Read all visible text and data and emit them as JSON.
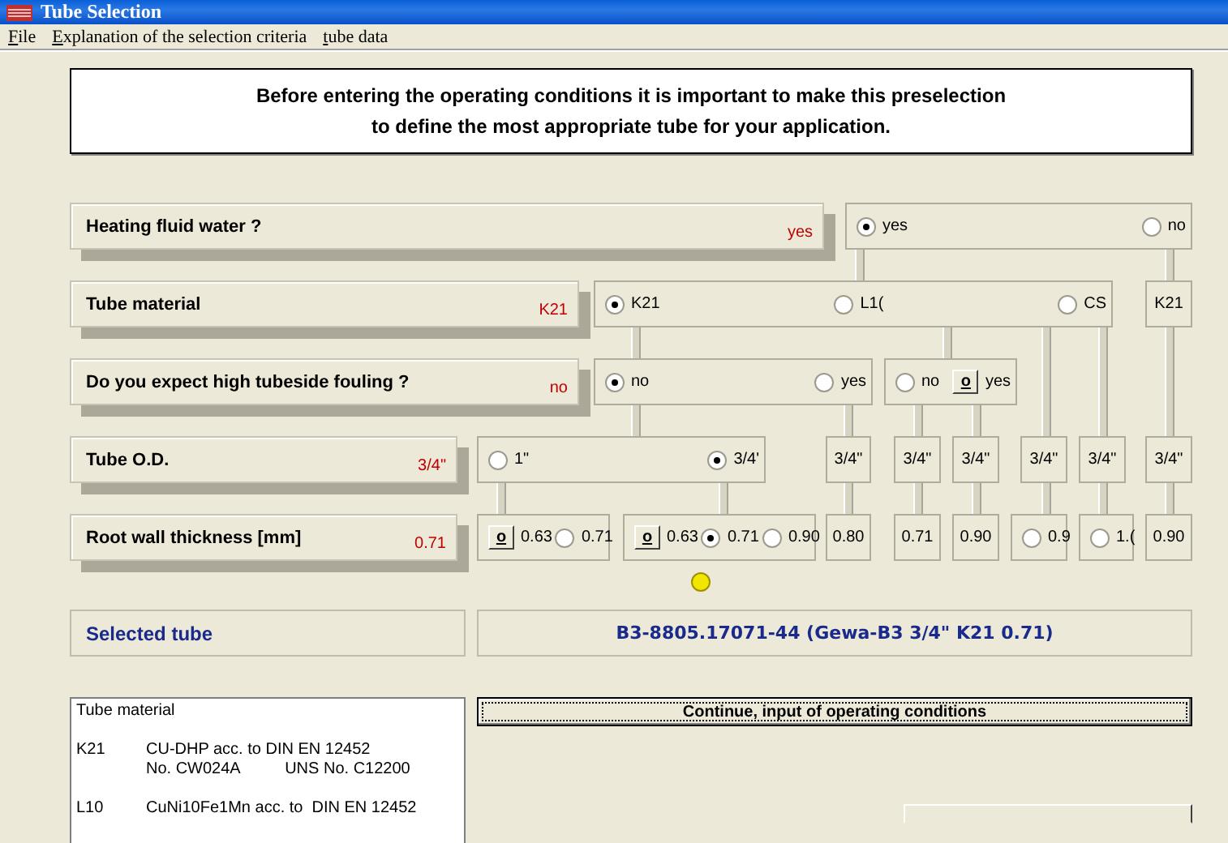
{
  "window": {
    "title": "Tube Selection"
  },
  "menu": [
    "File",
    "Explanation of the selection criteria",
    "tube data"
  ],
  "intro": [
    "Before entering the operating conditions it is important to make this preselection",
    "to define the most appropriate tube for your application."
  ],
  "questions": [
    {
      "label": "Heating fluid water ?",
      "value": "yes"
    },
    {
      "label": "Tube material",
      "value": "K21"
    },
    {
      "label": "Do you expect high tubeside fouling ?",
      "value": "no"
    },
    {
      "label": "Tube O.D.",
      "value": "3/4\""
    },
    {
      "label": "Root wall thickness [mm]",
      "value": "0.71"
    }
  ],
  "rows": [
    {
      "groups": [
        {
          "options": [
            {
              "kind": "radio",
              "label": "yes",
              "selected": true
            },
            {
              "kind": "radio",
              "label": "no",
              "selected": false
            }
          ]
        }
      ]
    },
    {
      "groups": [
        {
          "options": [
            {
              "kind": "radio",
              "label": "K21",
              "selected": true
            },
            {
              "kind": "radio",
              "label": "L1(",
              "selected": false
            },
            {
              "kind": "radio",
              "label": "CS",
              "selected": false
            }
          ]
        },
        {
          "options": [
            {
              "kind": "text",
              "label": "K21"
            }
          ]
        }
      ]
    },
    {
      "groups": [
        {
          "options": [
            {
              "kind": "radio",
              "label": "no",
              "selected": true
            },
            {
              "kind": "radio",
              "label": "yes",
              "selected": false
            }
          ]
        },
        {
          "options": [
            {
              "kind": "radio",
              "label": "no",
              "selected": false
            },
            {
              "kind": "button",
              "glyph": "o",
              "label": "yes"
            }
          ]
        }
      ]
    },
    {
      "groups": [
        {
          "options": [
            {
              "kind": "radio",
              "label": "1\"",
              "selected": false
            },
            {
              "kind": "radio",
              "label": "3/4'",
              "selected": true
            }
          ]
        },
        {
          "options": [
            {
              "kind": "text",
              "label": "3/4\""
            }
          ]
        },
        {
          "options": [
            {
              "kind": "text",
              "label": "3/4\""
            }
          ]
        },
        {
          "options": [
            {
              "kind": "text",
              "label": "3/4\""
            }
          ]
        },
        {
          "options": [
            {
              "kind": "text",
              "label": "3/4\""
            }
          ]
        },
        {
          "options": [
            {
              "kind": "text",
              "label": "3/4\""
            }
          ]
        },
        {
          "options": [
            {
              "kind": "text",
              "label": "3/4\""
            }
          ]
        }
      ]
    },
    {
      "groups": [
        {
          "options": [
            {
              "kind": "button",
              "glyph": "o",
              "label": "0.63"
            },
            {
              "kind": "radio",
              "label": "0.71",
              "selected": false
            }
          ]
        },
        {
          "options": [
            {
              "kind": "button",
              "glyph": "o",
              "label": "0.63"
            },
            {
              "kind": "radio",
              "label": "0.71",
              "selected": true
            },
            {
              "kind": "radio",
              "label": "0.90",
              "selected": false
            }
          ]
        },
        {
          "options": [
            {
              "kind": "text",
              "label": "0.80"
            }
          ]
        },
        {
          "options": [
            {
              "kind": "text",
              "label": "0.71"
            }
          ]
        },
        {
          "options": [
            {
              "kind": "text",
              "label": "0.90"
            }
          ]
        },
        {
          "options": [
            {
              "kind": "radio",
              "label": "0.9",
              "selected": false
            }
          ]
        },
        {
          "options": [
            {
              "kind": "radio",
              "label": "1.(",
              "selected": false
            }
          ]
        },
        {
          "options": [
            {
              "kind": "text",
              "label": "0.90"
            }
          ]
        }
      ]
    }
  ],
  "selected_tube": {
    "label": "Selected tube",
    "value": "B3-8805.17071-44  (Gewa-B3  3/4\"  K21 0.71)"
  },
  "listbox": {
    "title": "Tube material",
    "entries": [
      {
        "code": "K21",
        "lines": [
          "CU-DHP acc. to DIN EN 12452",
          "No. CW024A          UNS No. C12200"
        ]
      },
      {
        "code": "L10",
        "lines": [
          "CuNi10Fe1Mn acc. to  DIN EN 12452"
        ]
      }
    ]
  },
  "continue_button": "Continue, input of operating conditions"
}
